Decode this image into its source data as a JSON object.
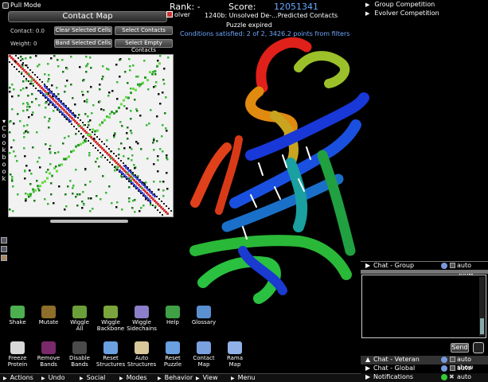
{
  "top_left": {
    "pull_mode": "Pull Mode"
  },
  "contact_map": {
    "title": "Contact Map",
    "contact_label": "Contact: 0.0",
    "weight_label": "Weight: 0",
    "buttons": [
      "Clear Selected Cells",
      "Select Contacts",
      "Band Selected Cells",
      "Select Empty Contacts"
    ]
  },
  "cookbook": {
    "letters": [
      "C",
      "o",
      "o",
      "k",
      "b",
      "o",
      "o",
      "k"
    ]
  },
  "header": {
    "rank_label": "Rank: -",
    "score_label": "Score:",
    "score_value": "12051341",
    "user": "olver",
    "puzzle_name": "1240b: Unsolved De-...Predicted Contacts",
    "puzzle_status": "Puzzle expired",
    "conditions": "Conditions satisfied: 2 of 2, 3426.2 points from filters"
  },
  "right_panel": {
    "competitions": [
      "Group Competition",
      "Evolver Competition"
    ],
    "chat_group": "Chat - Group",
    "auto_show": "auto show",
    "send": "Send",
    "chats": [
      {
        "label": "Chat - Veteran",
        "auto": "auto show"
      },
      {
        "label": "Chat - Global",
        "auto": "auto show"
      },
      {
        "label": "Notifications",
        "auto": "auto show"
      }
    ]
  },
  "tools_row1": [
    {
      "label": "Shake",
      "icon": "shake-icon",
      "color": "#4caf50"
    },
    {
      "label": "Mutate",
      "icon": "mutate-icon",
      "color": "#8d6e2a"
    },
    {
      "label": "Wiggle\nAll",
      "icon": "wiggle-all-icon",
      "color": "#6b9f3a"
    },
    {
      "label": "Wiggle\nBackbone",
      "icon": "wiggle-backbone-icon",
      "color": "#7aa53c"
    },
    {
      "label": "Wiggle\nSidechains",
      "icon": "wiggle-sidechains-icon",
      "color": "#8c7ec8"
    },
    {
      "label": "Help",
      "icon": "help-icon",
      "color": "#3fa046"
    },
    {
      "label": "Glossary",
      "icon": "glossary-icon",
      "color": "#5a8fd0"
    }
  ],
  "tools_row2": [
    {
      "label": "Freeze\nProtein",
      "icon": "freeze-icon",
      "color": "#d8d8d8"
    },
    {
      "label": "Remove\nBands",
      "icon": "remove-bands-icon",
      "color": "#7a2a6a"
    },
    {
      "label": "Disable\nBands",
      "icon": "disable-bands-icon",
      "color": "#4a4a4a"
    },
    {
      "label": "Reset\nStructures",
      "icon": "reset-structures-icon",
      "color": "#6a9fe0"
    },
    {
      "label": "Auto\nStructures",
      "icon": "auto-structures-icon",
      "color": "#d8c89a"
    },
    {
      "label": "Reset\nPuzzle",
      "icon": "reset-puzzle-icon",
      "color": "#6a9fe0"
    },
    {
      "label": "Contact\nMap",
      "icon": "contact-map-icon",
      "color": "#7aa0e0"
    },
    {
      "label": "Rama\nMap",
      "icon": "rama-map-icon",
      "color": "#90b0e8"
    }
  ],
  "bottom_menu": [
    "Actions",
    "Undo",
    "Social",
    "Modes",
    "Behavior",
    "View",
    "Menu"
  ]
}
